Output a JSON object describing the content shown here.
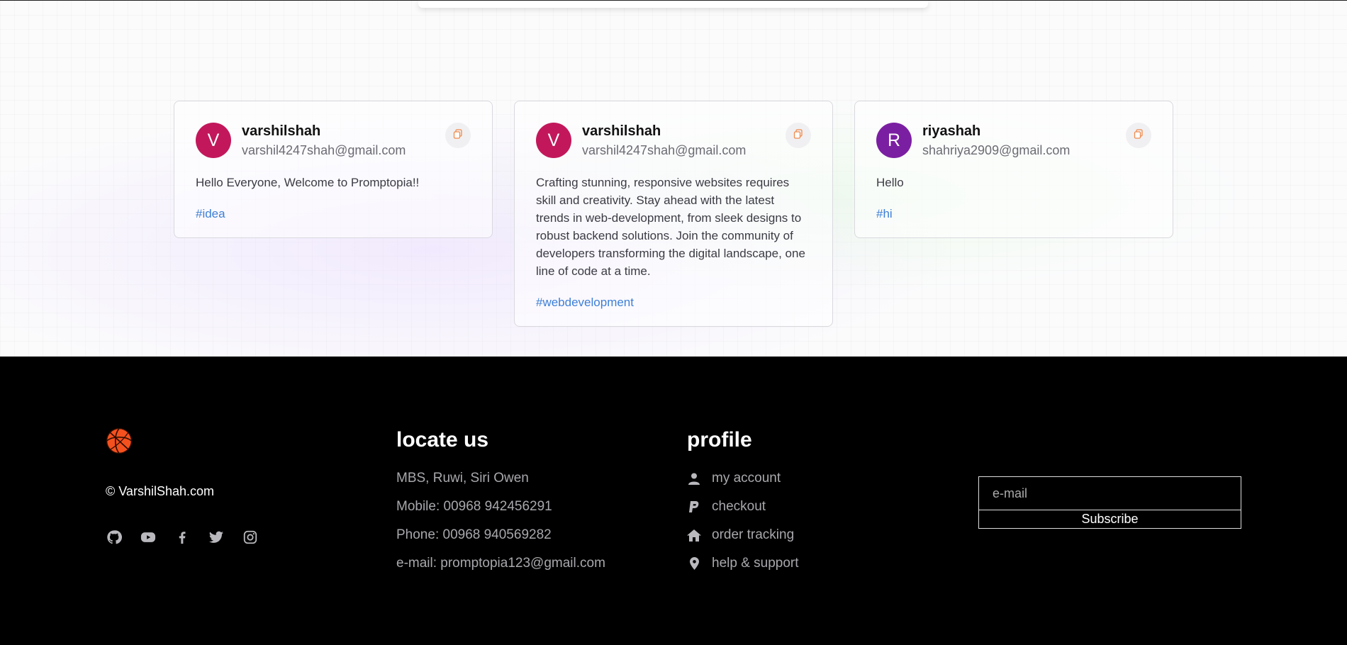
{
  "cards": [
    {
      "avatar_letter": "V",
      "avatar_color": "#c2185b",
      "username": "varshilshah",
      "email": "varshil4247shah@gmail.com",
      "prompt": "Hello Everyone, Welcome to Promptopia!!",
      "tag": "#idea"
    },
    {
      "avatar_letter": "V",
      "avatar_color": "#c2185b",
      "username": "varshilshah",
      "email": "varshil4247shah@gmail.com",
      "prompt": "Crafting stunning, responsive websites requires skill and creativity. Stay ahead with the latest trends in web-development, from sleek designs to robust backend solutions. Join the community of developers transforming the digital landscape, one line of code at a time.",
      "tag": "#webdevelopment"
    },
    {
      "avatar_letter": "R",
      "avatar_color": "#7b1fa2",
      "username": "riyashah",
      "email": "shahriya2909@gmail.com",
      "prompt": "Hello",
      "tag": "#hi"
    }
  ],
  "footer": {
    "copyright": "© VarshilShah.com",
    "socials": [
      "github-icon",
      "youtube-icon",
      "facebook-icon",
      "twitter-icon",
      "instagram-icon"
    ],
    "locate": {
      "title": "locate us",
      "lines": [
        "MBS, Ruwi, Siri Owen",
        "Mobile: 00968 942456291",
        "Phone: 00968 940569282",
        "e-mail: promptopia123@gmail.com"
      ]
    },
    "profile": {
      "title": "profile",
      "items": [
        {
          "icon": "user-icon",
          "label": "my account"
        },
        {
          "icon": "paypal-icon",
          "label": "checkout"
        },
        {
          "icon": "home-icon",
          "label": "order tracking"
        },
        {
          "icon": "map-pin-icon",
          "label": "help & support"
        }
      ]
    },
    "subscribe": {
      "placeholder": "e-mail",
      "button": "Subscribe"
    }
  },
  "colors": {
    "logo_orange": "#f4511e",
    "tag_blue": "#3d7fd6",
    "copy_orange": "#f08a4b"
  }
}
